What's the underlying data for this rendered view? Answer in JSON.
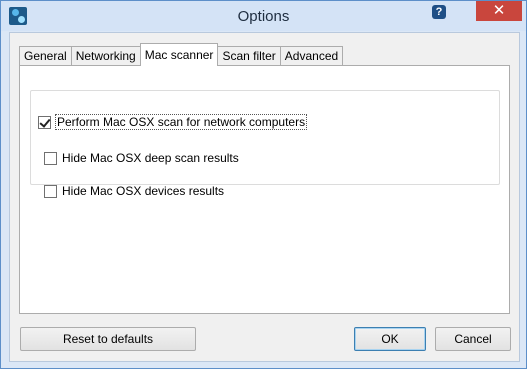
{
  "window": {
    "title": "Options",
    "help_glyph": "?",
    "close_glyph": "✕"
  },
  "tabs": [
    {
      "label": "General",
      "active": false
    },
    {
      "label": "Networking",
      "active": false
    },
    {
      "label": "Mac scanner",
      "active": true
    },
    {
      "label": "Scan filter",
      "active": false
    },
    {
      "label": "Advanced",
      "active": false
    }
  ],
  "options": {
    "perform_scan": {
      "label": "Perform Mac OSX scan for network computers",
      "checked": true
    },
    "hide_deep_scan": {
      "label": "Hide Mac OSX deep scan results",
      "checked": false
    },
    "hide_devices": {
      "label": "Hide Mac OSX devices results",
      "checked": false
    }
  },
  "buttons": {
    "reset": "Reset to defaults",
    "ok": "OK",
    "cancel": "Cancel"
  },
  "icons": {
    "app": "network-scanner-icon",
    "help": "help-icon",
    "close": "close-icon"
  }
}
